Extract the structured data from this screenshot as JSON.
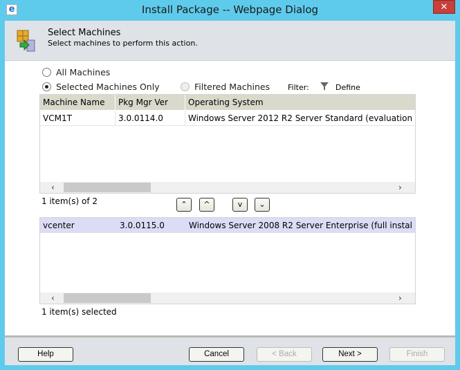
{
  "window": {
    "title": "Install Package -- Webpage Dialog",
    "close": "✕"
  },
  "header": {
    "title": "Select Machines",
    "subtitle": "Select machines to perform this action."
  },
  "options": {
    "all": "All Machines",
    "selected": "Selected Machines Only",
    "filtered": "Filtered Machines",
    "filter_label": "Filter:",
    "define": "Define",
    "selected_option": "selected"
  },
  "columns": [
    "Machine Name",
    "Pkg Mgr Ver",
    "Operating System"
  ],
  "available": {
    "rows": [
      [
        "VCM1T",
        "3.0.0114.0",
        "Windows Server 2012 R2 Server Standard (evaluation"
      ]
    ],
    "count": "1 item(s) of 2"
  },
  "selected": {
    "rows": [
      [
        "vcenter",
        "3.0.0115.0",
        "Windows Server 2008 R2 Server Enterprise (full instal"
      ]
    ],
    "count": "1 item(s) selected"
  },
  "move": {
    "top": "⌃",
    "up": "^",
    "down": "v",
    "bottom": "⌄"
  },
  "footer": {
    "help": "Help",
    "cancel": "Cancel",
    "back": "< Back",
    "next": "Next >",
    "finish": "Finish"
  }
}
